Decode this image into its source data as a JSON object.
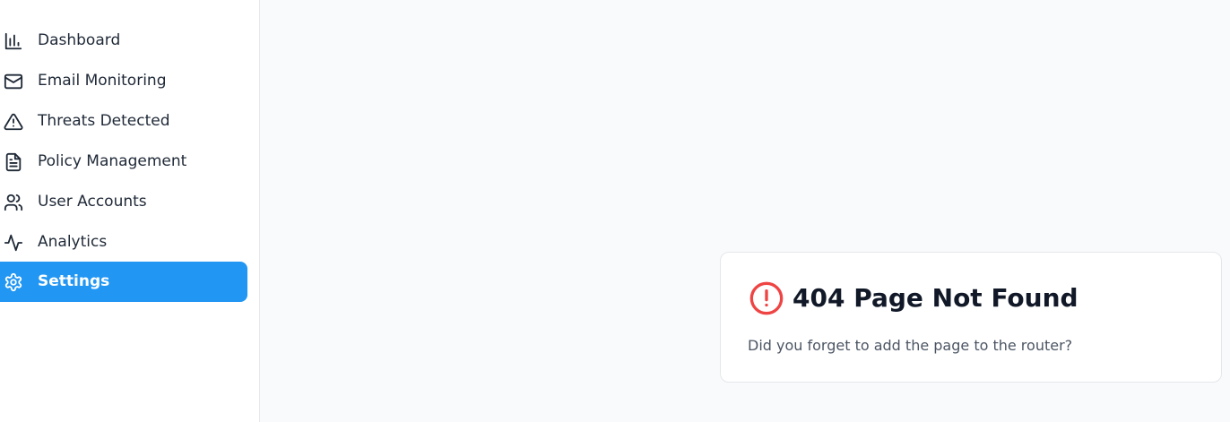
{
  "sidebar": {
    "items": [
      {
        "label": "Dashboard",
        "icon": "bar-chart-icon"
      },
      {
        "label": "Email Monitoring",
        "icon": "mail-icon"
      },
      {
        "label": "Threats Detected",
        "icon": "alert-triangle-icon"
      },
      {
        "label": "Policy Management",
        "icon": "file-text-icon"
      },
      {
        "label": "User Accounts",
        "icon": "users-icon"
      },
      {
        "label": "Analytics",
        "icon": "activity-icon"
      },
      {
        "label": "Settings",
        "icon": "settings-icon",
        "active": true
      }
    ]
  },
  "error_card": {
    "icon": "alert-circle-icon",
    "title": "404 Page Not Found",
    "message": "Did you forget to add the page to the router?"
  },
  "colors": {
    "active_bg": "#2196f3",
    "error": "#ef4444",
    "page_bg": "#f9fafb"
  }
}
